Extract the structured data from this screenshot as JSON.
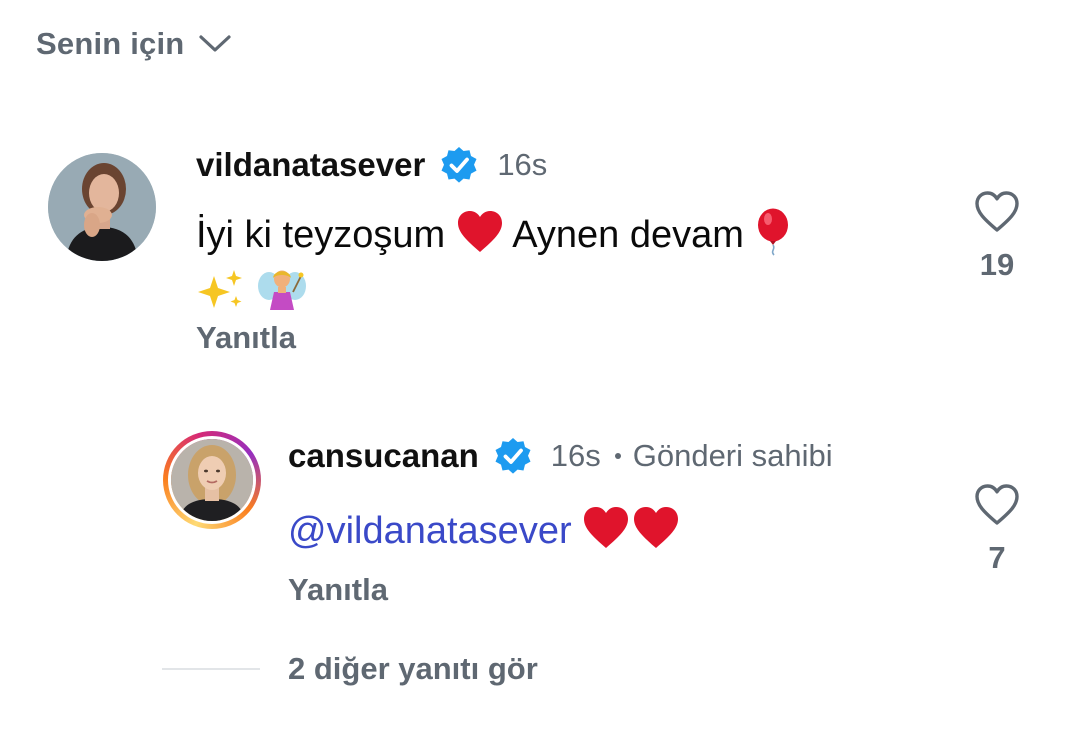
{
  "header": {
    "filter_label": "Senin için",
    "chevron_icon": "chevron-down-icon"
  },
  "comments": [
    {
      "username": "vildanatasever",
      "verified": true,
      "time": "16s",
      "text_parts": [
        "İyi ki teyzoşum",
        "Aynen devam"
      ],
      "emojis": [
        "red-heart-emoji",
        "balloon-emoji",
        "sparkles-emoji",
        "fairy-emoji"
      ],
      "reply_label": "Yanıtla",
      "like_count": "19"
    }
  ],
  "replies": [
    {
      "username": "cansucanan",
      "verified": true,
      "time": "16s",
      "owner_label": "Gönderi sahibi",
      "mention": "@vildanatasever",
      "emojis": [
        "red-heart-emoji",
        "red-heart-emoji"
      ],
      "reply_label": "Yanıtla",
      "like_count": "7"
    }
  ],
  "more_replies_label": "2 diğer yanıtı gör",
  "colors": {
    "verified": "#1d9bf0",
    "mention": "#3a49c8",
    "heart": "#e0142c",
    "muted": "#5f6872"
  }
}
